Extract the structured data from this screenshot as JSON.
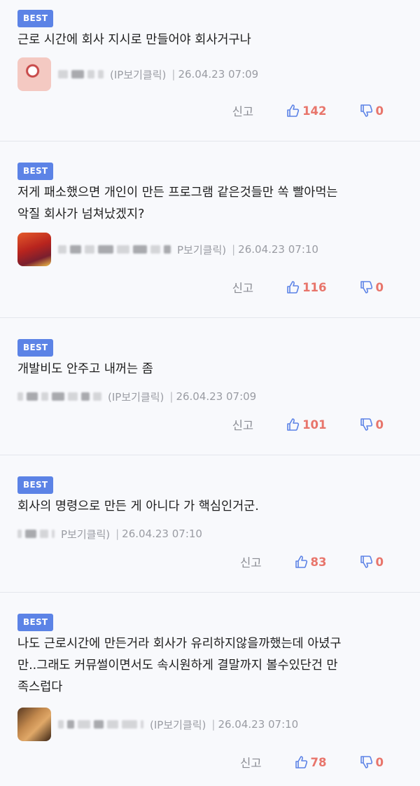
{
  "comments": [
    {
      "badge": "BEST",
      "text": "근로 시간에 회사 지시로 만들어야 회사거구나",
      "ip": "(IP보기클릭)",
      "date": "26.04.23 07:09",
      "report": "신고",
      "likes": "142",
      "dislikes": "0"
    },
    {
      "badge": "BEST",
      "text": "저게 패소했으면 개인이 만든 프로그램 같은것들만 쏙 빨아먹는\n악질 회사가 넘쳐났겠지?",
      "ip": "P보기클릭)",
      "date": "26.04.23 07:10",
      "report": "신고",
      "likes": "116",
      "dislikes": "0"
    },
    {
      "badge": "BEST",
      "text": "개발비도 안주고 내꺼는 좀",
      "ip": "(IP보기클릭)",
      "date": "26.04.23 07:09",
      "report": "신고",
      "likes": "101",
      "dislikes": "0"
    },
    {
      "badge": "BEST",
      "text": "회사의 명령으로 만든 게 아니다 가 핵심인거군.",
      "ip": "P보기클릭)",
      "date": "26.04.23 07:10",
      "report": "신고",
      "likes": "83",
      "dislikes": "0"
    },
    {
      "badge": "BEST",
      "text": "나도 근로시간에 만든거라 회사가 유리하지않을까했는데 아녔구\n만..그래도 커뮤썰이면서도 속시원하게 결말까지 볼수있단건 만\n족스럽다",
      "ip": "(IP보기클릭)",
      "date": "26.04.23 07:10",
      "report": "신고",
      "likes": "78",
      "dislikes": "0"
    }
  ],
  "colors": {
    "badge": "#5c83e6",
    "count": "#e8756b",
    "like_icon": "#5c83e6",
    "meta": "#9a9ca3",
    "background": "#f8f9fc"
  },
  "icons": {
    "like": "thumbs-up-icon",
    "dislike": "thumbs-down-icon"
  }
}
